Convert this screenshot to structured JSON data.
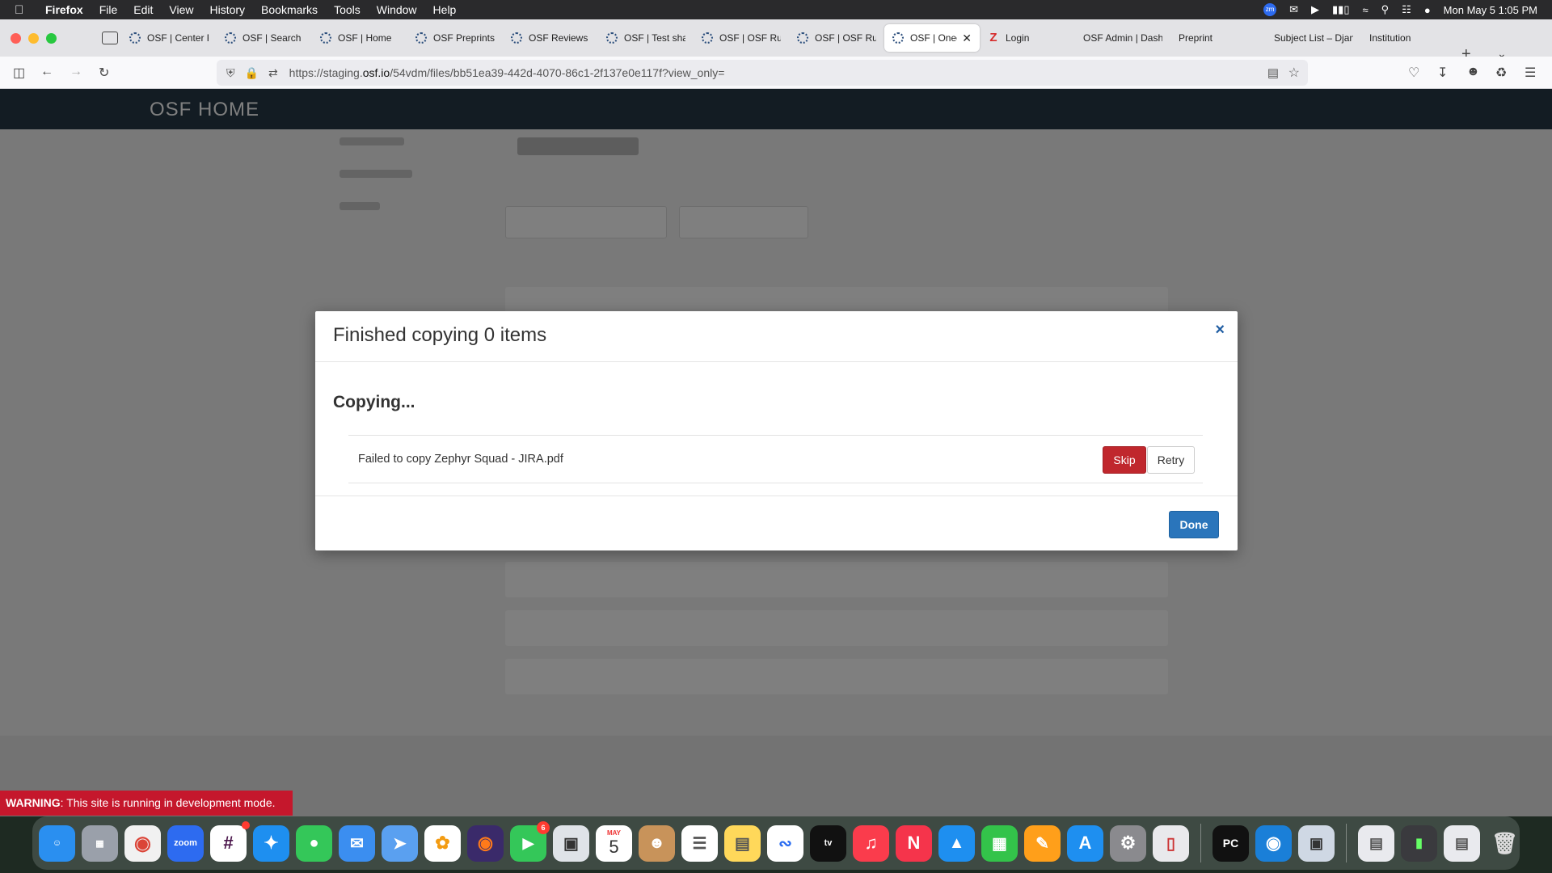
{
  "menubar": {
    "app_name": "Firefox",
    "menus": [
      "File",
      "Edit",
      "View",
      "History",
      "Bookmarks",
      "Tools",
      "Window",
      "Help"
    ],
    "datetime": "Mon May 5  1:05 PM",
    "zoom_icon_label": "zm"
  },
  "tabs": [
    {
      "label": "OSF | Center F",
      "icon": "osf-icon"
    },
    {
      "label": "OSF | Search",
      "icon": "osf-icon"
    },
    {
      "label": "OSF | Home",
      "icon": "osf-icon"
    },
    {
      "label": "OSF Preprints",
      "icon": "osf-icon"
    },
    {
      "label": "OSF Reviews",
      "icon": "osf-icon"
    },
    {
      "label": "OSF | Test sha",
      "icon": "osf-icon"
    },
    {
      "label": "OSF | OSF Run",
      "icon": "osf-icon"
    },
    {
      "label": "OSF | OSF Run",
      "icon": "osf-icon"
    },
    {
      "label": "OSF | Oned",
      "icon": "osf-icon",
      "active": true
    },
    {
      "label": "Login",
      "icon": "zephyr-icon"
    },
    {
      "label": "OSF Admin | Dashb",
      "icon": "none"
    },
    {
      "label": "Preprint",
      "icon": "none"
    },
    {
      "label": "Subject List – Djan",
      "icon": "none"
    },
    {
      "label": "Institution",
      "icon": "none"
    }
  ],
  "toolbar": {
    "url_prefix": "https://staging.",
    "url_domain": "osf.io",
    "url_suffix": "/54vdm/files/bb51ea39-442d-4070-86c1-2f137e0e117f?view_only="
  },
  "page": {
    "brand": "OSF HOME"
  },
  "modal": {
    "title": "Finished copying 0 items",
    "close_symbol": "×",
    "status": "Copying...",
    "fail_message": "Failed to copy Zephyr Squad - JIRA.pdf",
    "skip_label": "Skip",
    "retry_label": "Retry",
    "done_label": "Done"
  },
  "warning": {
    "prefix": "WARNING",
    "message": ": This site is running in development mode."
  },
  "dock": {
    "calendar_month": "MAY",
    "calendar_day": "5",
    "slack_badge": "",
    "facetime_badge": "6",
    "zoom_label": "zoom",
    "tv_label": "tv",
    "pycharm_label": "PC"
  },
  "colors": {
    "skip": "#c0272d",
    "done": "#2a75bb",
    "warning": "#c5172c",
    "close": "#1f5da2"
  }
}
